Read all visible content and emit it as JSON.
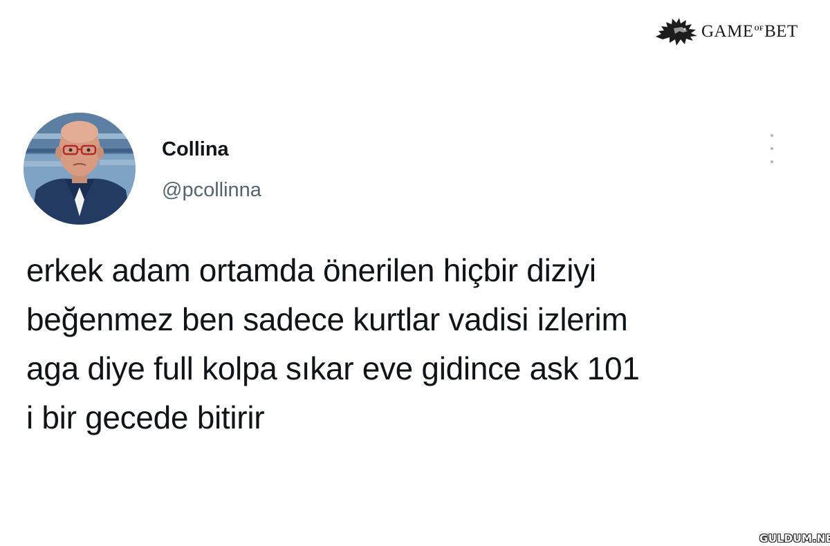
{
  "watermark": {
    "wordmark_left": "GAME",
    "wordmark_of": "OF",
    "wordmark_right": "BET",
    "icon": "wolf-icon"
  },
  "tweet": {
    "display_name": "Collina",
    "handle": "@pcollinna",
    "text": "erkek adam ortamda önerilen hiçbir diziyi\nbeğenmez ben sadece kurtlar vadisi izlerim\naga diye full kolpa sıkar eve gidince ask 101\ni bir gecede bitirir",
    "more_icon": "more-vertical-icon",
    "avatar_icon": "avatar"
  },
  "footer": {
    "site_watermark": "GULDUM.NET"
  },
  "colors": {
    "text": "#0f1419",
    "muted": "#536471",
    "background": "#ffffff"
  }
}
